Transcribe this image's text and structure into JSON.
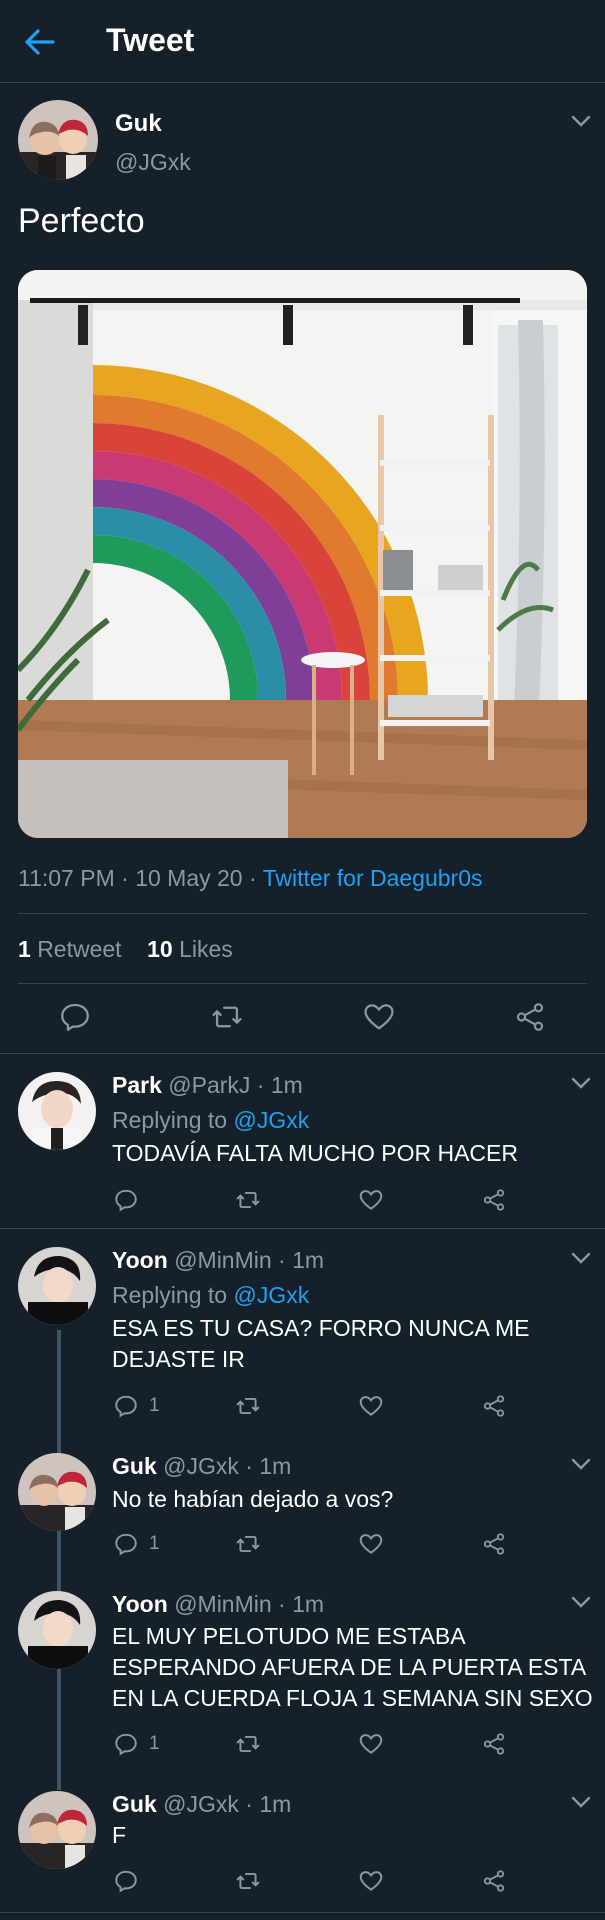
{
  "header": {
    "title": "Tweet"
  },
  "main_tweet": {
    "name": "Guk",
    "handle": "@JGxk",
    "text": "Perfecto",
    "time": "11:07 PM",
    "date": "10 May 20",
    "source": "Twitter for Daegubr0s",
    "retweets_count": "1",
    "retweets_label": "Retweet",
    "likes_count": "10",
    "likes_label": "Likes"
  },
  "replies": [
    {
      "name": "Park",
      "handle": "@ParkJ",
      "time": "1m",
      "replying_label": "Replying to",
      "replying_to": "@JGxk",
      "lines": [
        "TODAVÍA FALTA MUCHO POR HACER"
      ],
      "reply_count": ""
    },
    {
      "name": "Yoon",
      "handle": "@MinMin",
      "time": "1m",
      "replying_label": "Replying to",
      "replying_to": "@JGxk",
      "lines": [
        "ESA ES TU CASA? FORRO NUNCA ME",
        "DEJASTE IR"
      ],
      "reply_count": "1"
    },
    {
      "name": "Guk",
      "handle": "@JGxk",
      "time": "1m",
      "lines": [
        "No te habían dejado a vos?"
      ],
      "reply_count": "1"
    },
    {
      "name": "Yoon",
      "handle": "@MinMin",
      "time": "1m",
      "lines": [
        "EL MUY PELOTUDO ME ESTABA",
        "ESPERANDO AFUERA DE LA PUERTA ESTA",
        "EN LA CUERDA FLOJA 1 SEMANA SIN SEXO"
      ],
      "reply_count": "1"
    },
    {
      "name": "Guk",
      "handle": "@JGxk",
      "time": "1m",
      "lines": [
        "F"
      ],
      "reply_count": ""
    }
  ],
  "separator": " · ",
  "colors": {
    "background": "#15202b",
    "accent": "#1da1f2",
    "muted": "#8899a6",
    "divider": "#38444d"
  }
}
